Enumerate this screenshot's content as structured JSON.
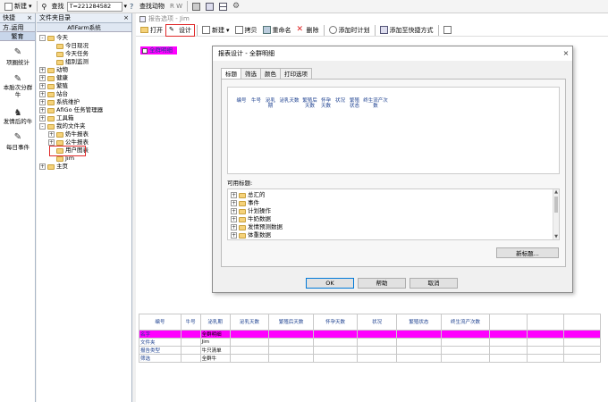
{
  "toolbar": {
    "new_label": "新建",
    "find_label": "查找",
    "search_value": "T=221284582",
    "find_animal_label": "查找动物",
    "flag_labels": "R  W"
  },
  "left_nav": {
    "title": "快捷方...",
    "tabs": [
      "运用",
      "繁育"
    ],
    "items": [
      "项圈统计",
      "本胎次分群牛",
      "发情后的牛",
      "每日事件"
    ]
  },
  "folder_tree": {
    "title": "文件夹目录",
    "root": "AfiFarm系统",
    "items": [
      {
        "label": "今天",
        "level": 0,
        "pm": "-"
      },
      {
        "label": "今日现况",
        "level": 1,
        "pm": ""
      },
      {
        "label": "今天任务",
        "level": 1,
        "pm": ""
      },
      {
        "label": "组别监测",
        "level": 1,
        "pm": ""
      },
      {
        "label": "动物",
        "level": 0,
        "pm": "+"
      },
      {
        "label": "健康",
        "level": 0,
        "pm": "+"
      },
      {
        "label": "繁殖",
        "level": 0,
        "pm": "+"
      },
      {
        "label": "站台",
        "level": 0,
        "pm": "+"
      },
      {
        "label": "系统维护",
        "level": 0,
        "pm": "+"
      },
      {
        "label": "AfiGo 任务管理器",
        "level": 0,
        "pm": "+"
      },
      {
        "label": "工具箱",
        "level": 0,
        "pm": "+"
      },
      {
        "label": "我的文件夹",
        "level": 0,
        "pm": "-"
      },
      {
        "label": "奶牛报表",
        "level": 1,
        "pm": "+"
      },
      {
        "label": "公牛报表",
        "level": 1,
        "pm": "+"
      },
      {
        "label": "用户图表",
        "level": 1,
        "pm": ""
      },
      {
        "label": "Jim",
        "level": 1,
        "pm": ""
      },
      {
        "label": "主页",
        "level": 0,
        "pm": "+"
      }
    ]
  },
  "report": {
    "breadcrumb": "报告选项 - Jim",
    "toolbar": {
      "open_label": "打开",
      "design_label": "设计",
      "new_label": "新建",
      "copy_label": "拷贝",
      "rename_label": "重命名",
      "delete_label": "删除",
      "add_plan_label": "添加时计划",
      "add_shortcut_label": "添加至快捷方式"
    },
    "selected_item": "全群明细"
  },
  "dialog": {
    "title": "报表设计 - 全群明细",
    "tabs": [
      "标题",
      "筛选",
      "颜色",
      "打印选项"
    ],
    "columns": [
      "编号",
      "牛号",
      "泌乳期",
      "泌乳天数",
      "繁殖后天数",
      "怀孕天数",
      "状况",
      "繁殖状态",
      "终生流产次数"
    ],
    "available_label": "可用标题:",
    "available_items": [
      "总汇的",
      "事件",
      "计划操作",
      "牛奶数据",
      "发情预测数据",
      "体重数据"
    ],
    "new_title_button": "新标题...",
    "ok_button": "OK",
    "help_button": "帮助",
    "cancel_button": "取消"
  },
  "bottom_grid": {
    "headers": [
      "编号",
      "牛号",
      "泌乳期",
      "泌乳天数",
      "繁殖后天数",
      "怀孕天数",
      "状况",
      "繁殖状态",
      "终生流产次数",
      "",
      "",
      ""
    ],
    "rows": [
      {
        "label": "名字",
        "value": "全群明细",
        "highlight": true
      },
      {
        "label": "文件夹",
        "value": "Jim",
        "highlight": false
      },
      {
        "label": "报告类型",
        "value": "牛只清单",
        "highlight": false
      },
      {
        "label": "筛选",
        "value": "全群牛",
        "highlight": false
      }
    ]
  },
  "colors": {
    "highlight": "#ff00ff",
    "annotation": "#e0292a",
    "link_text": "#1b3f8f"
  }
}
